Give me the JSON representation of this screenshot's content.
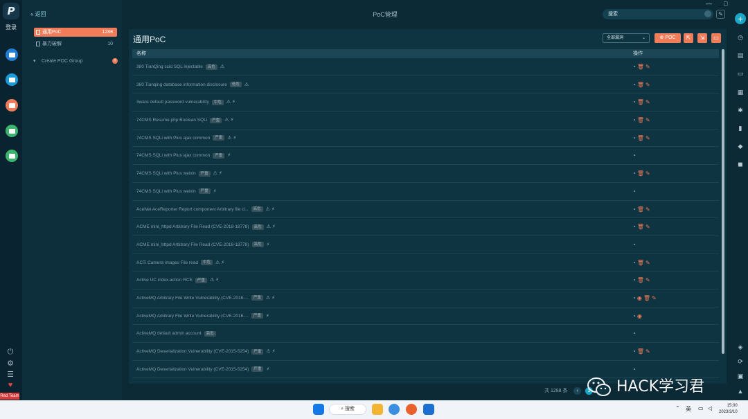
{
  "app": {
    "login_label": "登录",
    "team_label": "Red Team"
  },
  "sidebar": {
    "back_label": "« 返回",
    "items": [
      {
        "label": "通用PoC",
        "count": "1288",
        "active": true
      },
      {
        "label": "暴力破解",
        "count": "10",
        "active": false
      }
    ],
    "group_label": "Create POC Group",
    "group_add": "+"
  },
  "topbar": {
    "title": "PoC管理",
    "search_placeholder": "搜索",
    "window_controls": [
      "—",
      "□",
      "✕"
    ]
  },
  "panel": {
    "title": "通用PoC",
    "filter_value": "全部漏洞",
    "poc_button": "POC",
    "columns": [
      "名称",
      "操作"
    ],
    "rows": [
      {
        "name": "360 TianQing ccid SQL injectable",
        "level": "高危",
        "flags": "⚠",
        "ops": [
          "g",
          "r",
          "r"
        ]
      },
      {
        "name": "360 Tianqing database information disclosure",
        "level": "低危",
        "flags": "⚠",
        "ops": [
          "g",
          "r",
          "r"
        ]
      },
      {
        "name": "3ware default password vulnerability",
        "level": "中危",
        "flags": "⚠ ⚡",
        "ops": [
          "g",
          "r",
          "r"
        ]
      },
      {
        "name": "74CMS Resume.php Boolean SQLi",
        "level": "严重",
        "flags": "⚠ ⚡",
        "ops": [
          "g",
          "r",
          "r"
        ]
      },
      {
        "name": "74CMS SQLi with Plus ajax common",
        "level": "严重",
        "flags": "⚠ ⚡",
        "ops": [
          "g",
          "r",
          "r"
        ]
      },
      {
        "name": "74CMS SQLi with Plus ajax common",
        "level": "严重",
        "flags": "⚡",
        "ops": [
          "g"
        ]
      },
      {
        "name": "74CMS SQLi with Plus weixin",
        "level": "严重",
        "flags": "⚠ ⚡",
        "ops": [
          "g",
          "r",
          "r"
        ]
      },
      {
        "name": "74CMS SQLi with Plus weixin",
        "level": "严重",
        "flags": "⚡",
        "ops": [
          "g"
        ]
      },
      {
        "name": "AceNet AceReporter Report component Arbitrary file d...",
        "level": "高危",
        "flags": "⚠ ⚡",
        "ops": [
          "g",
          "r",
          "r"
        ]
      },
      {
        "name": "ACME mini_httpd Arbitrary File Read (CVE-2018-18778)",
        "level": "高危",
        "flags": "⚠ ⚡",
        "ops": [
          "g",
          "r",
          "r"
        ]
      },
      {
        "name": "ACME mini_httpd Arbitrary File Read (CVE-2018-18778)",
        "level": "高危",
        "flags": "⚡",
        "ops": [
          "g"
        ]
      },
      {
        "name": "ACTi Camera images File read",
        "level": "中危",
        "flags": "⚠ ⚡",
        "ops": [
          "g",
          "r",
          "r"
        ]
      },
      {
        "name": "Active UC index.action RCE",
        "level": "严重",
        "flags": "⚠ ⚡",
        "ops": [
          "g",
          "r",
          "r"
        ]
      },
      {
        "name": "ActiveMQ Arbitrary File Write Vulnerability (CVE-2016-...",
        "level": "严重",
        "flags": "⚠ ⚡",
        "ops": [
          "g",
          "e",
          "r",
          "r"
        ]
      },
      {
        "name": "ActiveMQ Arbitrary File Write Vulnerability (CVE-2016-...",
        "level": "严重",
        "flags": "⚡",
        "ops": [
          "g",
          "e"
        ]
      },
      {
        "name": "ActiveMQ default admin account",
        "level": "高危",
        "flags": "",
        "ops": [
          "g"
        ]
      },
      {
        "name": "ActiveMQ Deserialization Vulnerability (CVE-2015-5254)",
        "level": "严重",
        "flags": "⚠ ⚡",
        "ops": [
          "g",
          "r",
          "r"
        ]
      },
      {
        "name": "ActiveMQ Deserialization Vulnerability (CVE-2015-5254)",
        "level": "严重",
        "flags": "⚡",
        "ops": [
          "g"
        ]
      }
    ]
  },
  "pagination": {
    "total": "共 1288 条",
    "current": "1"
  },
  "taskbar": {
    "search": "搜索",
    "ime": "英",
    "time": "15:00",
    "date": "2023/3/10"
  },
  "watermark": "HACK学习君",
  "colors": {
    "accent": "#f07c5a",
    "bg": "#0b2a36",
    "panel": "#0f3441"
  }
}
